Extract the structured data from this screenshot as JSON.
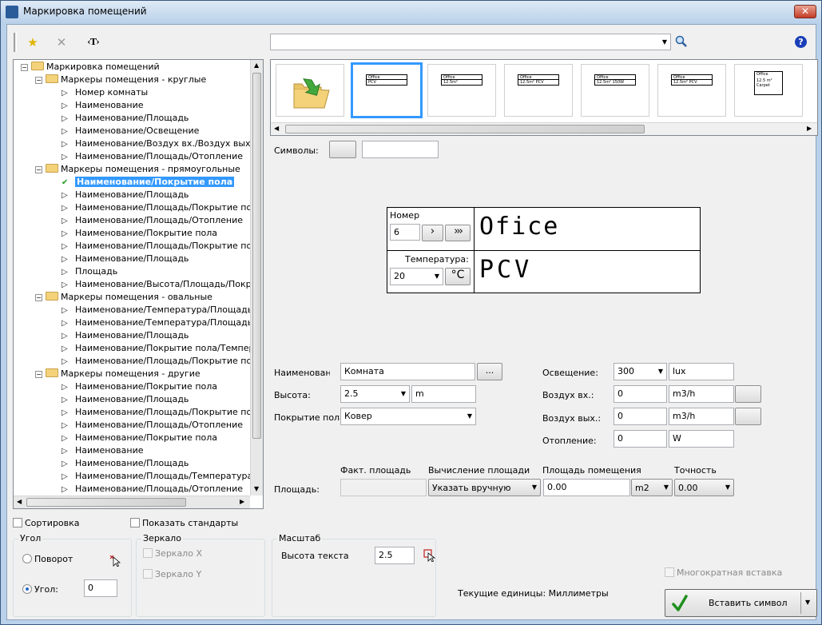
{
  "window": {
    "title": "Маркировка помещений",
    "close_label": "✕"
  },
  "toolbar": {
    "favorites_icon": "star-icon",
    "delete_icon": "cross-icon",
    "text_tool_label": "‹T›",
    "search_value": "",
    "help_label": "?"
  },
  "tree": {
    "root": "Маркировка помещений",
    "rows": [
      {
        "type": "folder",
        "label": "Маркеры помещения - круглые"
      },
      {
        "type": "leaf",
        "label": "Номер комнаты"
      },
      {
        "type": "leaf",
        "label": "Наименование"
      },
      {
        "type": "leaf",
        "label": "Наименование/Площадь"
      },
      {
        "type": "leaf",
        "label": "Наименование/Освещение"
      },
      {
        "type": "leaf",
        "label": "Наименование/Воздух вх./Воздух вых."
      },
      {
        "type": "leaf",
        "label": "Наименование/Площадь/Отопление"
      },
      {
        "type": "folder",
        "label": "Маркеры помещения - прямоугольные"
      },
      {
        "type": "leaf",
        "label": "Наименование/Покрытие пола",
        "selected": true
      },
      {
        "type": "leaf",
        "label": "Наименование/Площадь"
      },
      {
        "type": "leaf",
        "label": "Наименование/Площадь/Покрытие пола"
      },
      {
        "type": "leaf",
        "label": "Наименование/Площадь/Отопление"
      },
      {
        "type": "leaf",
        "label": "Наименование/Покрытие пола"
      },
      {
        "type": "leaf",
        "label": "Наименование/Площадь/Покрытие пола"
      },
      {
        "type": "leaf",
        "label": "Наименование/Площадь"
      },
      {
        "type": "leaf",
        "label": "Площадь"
      },
      {
        "type": "leaf",
        "label": "Наименование/Высота/Площадь/Покрытие"
      },
      {
        "type": "folder",
        "label": "Маркеры помещения - овальные"
      },
      {
        "type": "leaf",
        "label": "Наименование/Температура/Площадь"
      },
      {
        "type": "leaf",
        "label": "Наименование/Температура/Площадь/Отоп"
      },
      {
        "type": "leaf",
        "label": "Наименование/Площадь"
      },
      {
        "type": "leaf",
        "label": "Наименование/Покрытие пола/Температур"
      },
      {
        "type": "leaf",
        "label": "Наименование/Площадь/Покрытие пола/Т"
      },
      {
        "type": "folder",
        "label": "Маркеры помещения - другие"
      },
      {
        "type": "leaf",
        "label": "Наименование/Покрытие пола"
      },
      {
        "type": "leaf",
        "label": "Наименование/Площадь"
      },
      {
        "type": "leaf",
        "label": "Наименование/Площадь/Покрытие пола"
      },
      {
        "type": "leaf",
        "label": "Наименование/Площадь/Отопление"
      },
      {
        "type": "leaf",
        "label": "Наименование/Покрытие пола"
      },
      {
        "type": "leaf",
        "label": "Наименование"
      },
      {
        "type": "leaf",
        "label": "Наименование/Площадь"
      },
      {
        "type": "leaf",
        "label": "Наименование/Площадь/Температура"
      },
      {
        "type": "leaf",
        "label": "Наименование/Площадь/Отопление"
      }
    ]
  },
  "gallery": {
    "items": [
      {
        "line1": "Office",
        "line2": "PCV"
      },
      {
        "line1": "Office",
        "line2": "12.5m²"
      },
      {
        "line1": "Office",
        "line2": "12.5m² PCV"
      },
      {
        "line1": "Office",
        "line2": "12.5m² 150W"
      },
      {
        "line1": "Office",
        "line2": "12.5m² PCV"
      },
      {
        "line1": "Office",
        "line2": "12.5 m² Carpet"
      }
    ]
  },
  "symbols": {
    "label": "Символы:",
    "value": ""
  },
  "preview": {
    "number_label": "Номер",
    "number_value": "6",
    "next_label": "›",
    "next_all_label": "›››",
    "name_text": "Ofice",
    "temp_label": "Температура:",
    "temp_value": "20",
    "temp_unit": "°C",
    "floor_text": "PCV"
  },
  "form": {
    "name_label": "Наименование",
    "name_value": "Комната",
    "browse_label": "...",
    "height_label": "Высота:",
    "height_value": "2.5",
    "height_unit": "m",
    "floor_label": "Покрытие пола:",
    "floor_value": "Ковер",
    "light_label": "Освещение:",
    "light_value": "300",
    "light_unit": "lux",
    "air_in_label": "Воздух вх.:",
    "air_in_value": "0",
    "air_in_unit": "m3/h",
    "air_out_label": "Воздух вых.:",
    "air_out_value": "0",
    "air_out_unit": "m3/h",
    "heating_label": "Отопление:",
    "heating_value": "0",
    "heating_unit": "W"
  },
  "area": {
    "label": "Площадь:",
    "actual_header": "Факт. площадь",
    "calc_header": "Вычисление площади",
    "room_header": "Площадь помещения",
    "precision_header": "Точность",
    "actual_value": "",
    "calc_value": "Указать вручную",
    "room_value": "0.00",
    "room_unit": "m2",
    "precision_value": "0.00"
  },
  "options": {
    "sort_label": "Сортировка",
    "show_std_label": "Показать стандарты",
    "angle_group": "Угол",
    "rotation_label": "Поворот",
    "angle_label": "Угол:",
    "angle_value": "0",
    "mirror_group": "Зеркало",
    "mirror_x": "Зеркало X",
    "mirror_y": "Зеркало Y",
    "scale_group": "Масштаб",
    "text_height_label": "Высота текста",
    "text_height_value": "2.5",
    "multi_insert_label": "Многократная вставка",
    "units_text": "Текущие единицы: Миллиметры",
    "insert_label": "Вставить символ"
  }
}
